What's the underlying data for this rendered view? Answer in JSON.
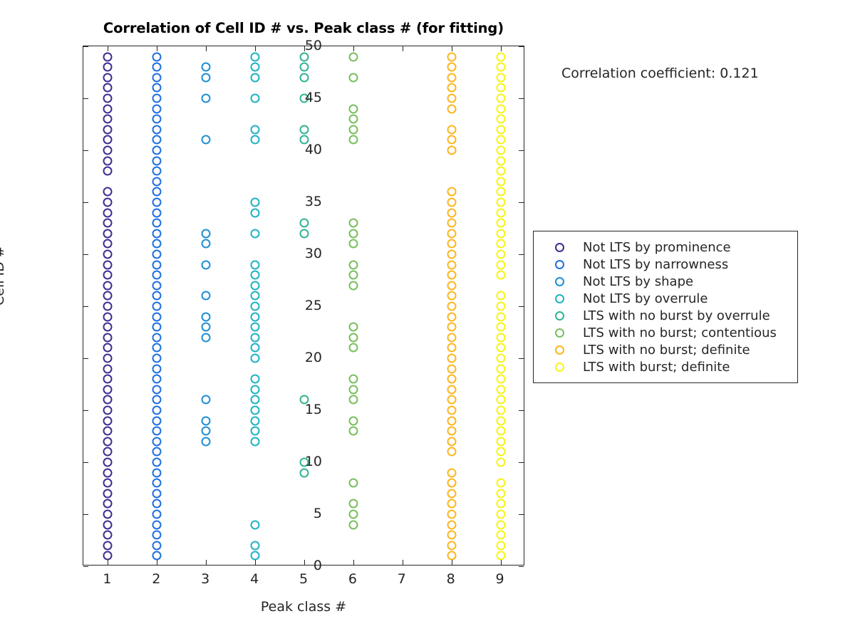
{
  "chart_data": {
    "type": "scatter",
    "title": "Correlation of Cell ID # vs. Peak class # (for fitting)",
    "xlabel": "Peak class #",
    "ylabel": "Cell ID #",
    "xlim": [
      0.5,
      9.5
    ],
    "ylim": [
      0,
      50
    ],
    "xticks": [
      1,
      2,
      3,
      4,
      5,
      6,
      7,
      8,
      9
    ],
    "yticks": [
      0,
      5,
      10,
      15,
      20,
      25,
      30,
      35,
      40,
      45,
      50
    ],
    "grid": false,
    "annotation": "Correlation coefficient: 0.121",
    "legend_position": "right",
    "marker_style": "open-circle",
    "series": [
      {
        "name": "Not LTS by prominence",
        "color": "#3b2f8f",
        "x": 1,
        "y": [
          1,
          2,
          3,
          4,
          5,
          6,
          7,
          8,
          9,
          10,
          11,
          12,
          13,
          14,
          15,
          16,
          17,
          18,
          19,
          20,
          21,
          22,
          23,
          24,
          25,
          26,
          27,
          28,
          29,
          30,
          31,
          32,
          33,
          34,
          35,
          36,
          38,
          39,
          40,
          41,
          42,
          43,
          44,
          45,
          46,
          47,
          48,
          49
        ]
      },
      {
        "name": "Not LTS by narrowness",
        "color": "#1f6fe0",
        "x": 2,
        "y": [
          1,
          2,
          3,
          4,
          5,
          6,
          7,
          8,
          9,
          10,
          11,
          12,
          13,
          14,
          15,
          16,
          17,
          18,
          19,
          20,
          21,
          22,
          23,
          24,
          25,
          26,
          27,
          28,
          29,
          30,
          31,
          32,
          33,
          34,
          35,
          36,
          37,
          38,
          39,
          40,
          41,
          42,
          43,
          44,
          45,
          46,
          47,
          48,
          49
        ]
      },
      {
        "name": "Not LTS by shape",
        "color": "#1f8fd4",
        "x": 3,
        "y": [
          12,
          13,
          14,
          16,
          22,
          23,
          24,
          26,
          29,
          31,
          32,
          41,
          45,
          47,
          48
        ]
      },
      {
        "name": "Not LTS by overrule",
        "color": "#1fb2c4",
        "x": 4,
        "y": [
          1,
          2,
          4,
          12,
          13,
          14,
          15,
          16,
          17,
          18,
          20,
          21,
          22,
          23,
          24,
          25,
          26,
          27,
          28,
          29,
          32,
          34,
          35,
          41,
          42,
          45,
          47,
          48,
          49
        ]
      },
      {
        "name": "LTS with no burst by overrule",
        "color": "#32b493",
        "x": 5,
        "y": [
          9,
          10,
          16,
          32,
          33,
          41,
          42,
          45,
          47,
          48,
          49
        ]
      },
      {
        "name": "LTS with no burst; contentious",
        "color": "#79be5e",
        "x": 6,
        "y": [
          4,
          5,
          6,
          8,
          13,
          14,
          16,
          17,
          18,
          21,
          22,
          23,
          27,
          28,
          29,
          31,
          32,
          33,
          41,
          42,
          43,
          44,
          47,
          49
        ]
      },
      {
        "name": "LTS with no burst; definite",
        "color": "#fcb61f",
        "x": 8,
        "y": [
          1,
          2,
          3,
          4,
          5,
          6,
          7,
          8,
          9,
          11,
          12,
          13,
          14,
          15,
          16,
          17,
          18,
          19,
          20,
          21,
          22,
          23,
          24,
          25,
          26,
          27,
          28,
          29,
          30,
          31,
          32,
          33,
          34,
          35,
          36,
          40,
          41,
          42,
          44,
          45,
          46,
          47,
          48,
          49
        ]
      },
      {
        "name": "LTS with burst; definite",
        "color": "#f7f317",
        "x": 9,
        "y": [
          1,
          2,
          3,
          4,
          5,
          6,
          7,
          8,
          10,
          11,
          12,
          13,
          14,
          15,
          16,
          17,
          18,
          19,
          20,
          21,
          22,
          23,
          24,
          25,
          26,
          28,
          29,
          30,
          31,
          32,
          33,
          34,
          35,
          36,
          37,
          38,
          39,
          40,
          41,
          42,
          43,
          44,
          45,
          46,
          47,
          48,
          49
        ]
      }
    ]
  },
  "legend": {
    "items": [
      {
        "label": "Not LTS by prominence",
        "color": "#3b2f8f"
      },
      {
        "label": "Not LTS by narrowness",
        "color": "#1f6fe0"
      },
      {
        "label": "Not LTS by shape",
        "color": "#1f8fd4"
      },
      {
        "label": "Not LTS by overrule",
        "color": "#1fb2c4"
      },
      {
        "label": "LTS with no burst by overrule",
        "color": "#32b493"
      },
      {
        "label": "LTS with no burst; contentious",
        "color": "#79be5e"
      },
      {
        "label": "LTS with no burst; definite",
        "color": "#fcb61f"
      },
      {
        "label": "LTS with burst; definite",
        "color": "#f7f317"
      }
    ]
  }
}
